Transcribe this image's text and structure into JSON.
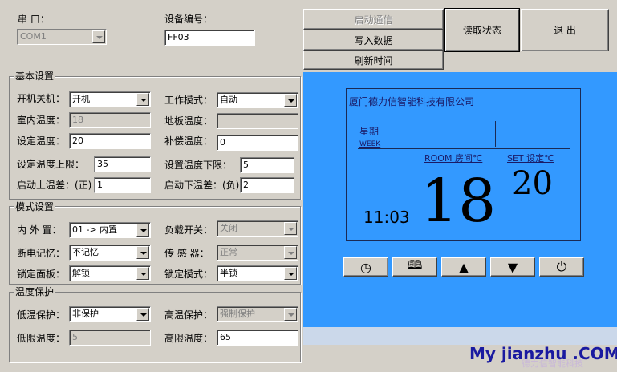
{
  "top": {
    "port_label": "串    口：",
    "port_value": "COM1",
    "device_label": "设备编号：",
    "device_value": "FF03"
  },
  "actions": {
    "start_comm": "启动通信",
    "write_data": "写入数据",
    "refresh_time": "刷新时间",
    "read_status": "读取状态",
    "exit": "退 出"
  },
  "basic": {
    "title": "基本设置",
    "power_label": "开机关机：",
    "power_value": "开机",
    "mode_label": "工作模式：",
    "mode_value": "自动",
    "room_temp_label": "室内温度：",
    "room_temp_value": "18",
    "floor_temp_label": "地板温度：",
    "floor_temp_value": "",
    "set_temp_label": "设定温度：",
    "set_temp_value": "20",
    "comp_temp_label": "补偿温度：",
    "comp_temp_value": "0",
    "upper_limit_label": "设定温度上限：",
    "upper_limit_value": "35",
    "lower_limit_label": "设置温度下限：",
    "lower_limit_value": "5",
    "start_up_diff_label": "启动上温差：(正)",
    "start_up_diff_value": "1",
    "start_down_diff_label": "启动下温差：(负)",
    "start_down_diff_value": "2"
  },
  "mode": {
    "title": "模式设置",
    "in_out_label": "内 外 置：",
    "in_out_value": "01 -> 内置",
    "load_switch_label": "负载开关：",
    "load_switch_value": "关闭",
    "memory_label": "断电记忆：",
    "memory_value": "不记忆",
    "sensor_label": "传 感 器：",
    "sensor_value": "正常",
    "lock_panel_label": "锁定面板：",
    "lock_panel_value": "解锁",
    "lock_mode_label": "锁定模式：",
    "lock_mode_value": "半锁"
  },
  "protect": {
    "title": "温度保护",
    "low_protect_label": "低温保护：",
    "low_protect_value": "非保护",
    "high_protect_label": "高温保护：",
    "high_protect_value": "强制保护",
    "low_limit_label": "低限温度：",
    "low_limit_value": "5",
    "high_limit_label": "高限温度：",
    "high_limit_value": "65"
  },
  "display": {
    "company": "厦门德力信智能科技有限公司",
    "week_cn": "星期",
    "week_en": "WEEK",
    "room_label": "ROOM 房间℃",
    "set_label": "SET 设定℃",
    "time": "11:03",
    "room_temp": "18",
    "set_temp": "20"
  },
  "panel_buttons": {
    "clock_icon": "◷",
    "book_icon": "🕮",
    "up_icon": "▲",
    "down_icon": "▼",
    "power_icon": "⏻"
  },
  "watermark": {
    "text": "My jianzhu .COM",
    "sub": "德力信智能科技"
  }
}
